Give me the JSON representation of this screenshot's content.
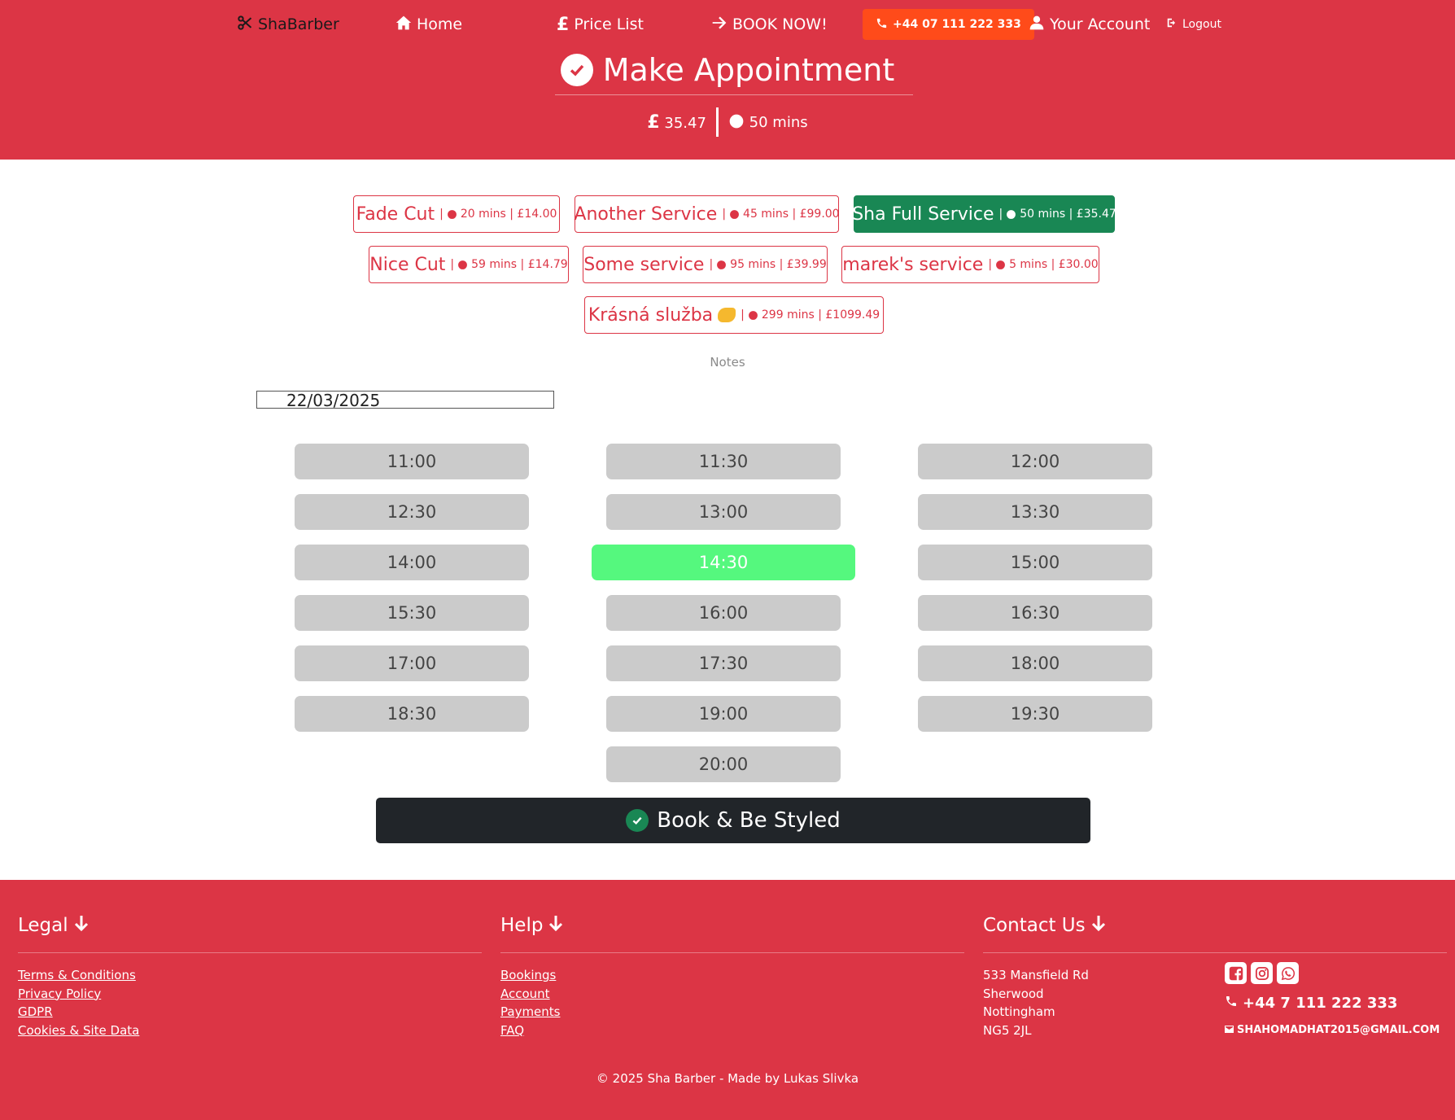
{
  "colors": {
    "primary_red": "#dc3545",
    "phone_orange": "#ff4b1a",
    "selected_service_green": "#198754",
    "selected_time_green": "#55f87e",
    "time_slot_gray": "#cbcbcb",
    "book_button_dark": "#212529"
  },
  "nav": {
    "brand": "ShaBarber",
    "home": "Home",
    "price_list": "Price List",
    "book_now": "BOOK NOW!",
    "phone": "+44 07 111 222 333",
    "account": "Your Account",
    "logout": "Logout",
    "icons": [
      "scissors-icon",
      "home-icon",
      "pound-icon",
      "arrow-right-icon",
      "phone-icon",
      "user-icon",
      "logout-icon"
    ]
  },
  "header": {
    "title": "Make Appointment",
    "price": "35.47",
    "currency_symbol": "£",
    "duration": "50 mins"
  },
  "services": [
    {
      "name": "Fade Cut",
      "meta": "20 mins | £14.00",
      "selected": false
    },
    {
      "name": "Another Service",
      "meta": "45 mins | £99.00",
      "selected": false
    },
    {
      "name": "Sha Full Service",
      "meta": "50 mins | £35.47",
      "selected": true
    },
    {
      "name": "Nice Cut",
      "meta": "59 mins | £14.79",
      "selected": false
    },
    {
      "name": "Some service",
      "meta": "95 mins | £39.99",
      "selected": false
    },
    {
      "name": "marek's service",
      "meta": "5 mins | £30.00",
      "selected": false
    },
    {
      "name": "Krásná služba",
      "meta": "299 mins | £1099.49",
      "selected": false,
      "emoji": "flexed-biceps-icon"
    }
  ],
  "service_separator": "|",
  "notes_label": "Notes",
  "date_value": "22/03/2025",
  "times": [
    "11:00",
    "11:30",
    "12:00",
    "12:30",
    "13:00",
    "13:30",
    "14:00",
    "14:30",
    "15:00",
    "15:30",
    "16:00",
    "16:30",
    "17:00",
    "17:30",
    "18:00",
    "18:30",
    "19:00",
    "19:30",
    "20:00"
  ],
  "selected_time": "14:30",
  "book_button": "Book & Be Styled",
  "footer": {
    "legal": {
      "heading": "Legal",
      "links": [
        "Terms & Conditions",
        "Privacy Policy",
        "GDPR",
        "Cookies & Site Data"
      ]
    },
    "help": {
      "heading": "Help",
      "links": [
        "Bookings",
        "Account",
        "Payments",
        "FAQ"
      ]
    },
    "contact": {
      "heading": "Contact Us",
      "address": [
        "533 Mansfield Rd",
        "Sherwood",
        "Nottingham",
        "NG5 2JL"
      ],
      "phone": "+44 7 111 222 333",
      "email": "SHAHOMADHAT2015@GMAIL.COM",
      "social_icons": [
        "facebook-icon",
        "instagram-icon",
        "whatsapp-icon"
      ]
    },
    "copyright": "© 2025 Sha Barber - Made by Lukas Slivka"
  }
}
